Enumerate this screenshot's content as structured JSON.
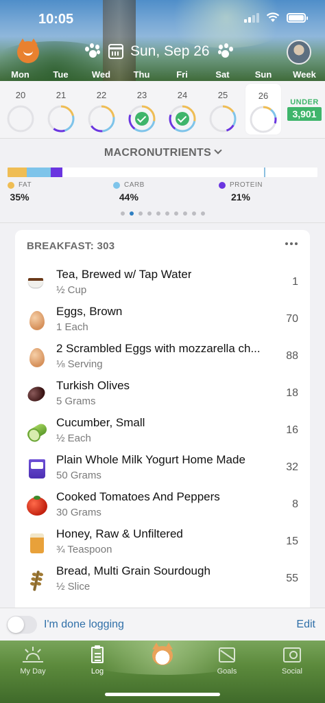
{
  "status": {
    "time": "10:05"
  },
  "header": {
    "date": "Sun, Sep 26",
    "weekdays": [
      "Mon",
      "Tue",
      "Wed",
      "Thu",
      "Fri",
      "Sat",
      "Sun",
      "Week"
    ]
  },
  "days": [
    {
      "num": "20",
      "fraction": 0.0,
      "done": false,
      "selected": false
    },
    {
      "num": "21",
      "fraction": 0.6,
      "done": false,
      "selected": false
    },
    {
      "num": "22",
      "fraction": 0.65,
      "done": false,
      "selected": false
    },
    {
      "num": "23",
      "fraction": 0.8,
      "done": true,
      "selected": false
    },
    {
      "num": "24",
      "fraction": 0.8,
      "done": true,
      "selected": false
    },
    {
      "num": "25",
      "fraction": 0.45,
      "done": false,
      "selected": false
    },
    {
      "num": "26",
      "fraction": 0.3,
      "done": false,
      "selected": true
    }
  ],
  "under": {
    "label": "UNDER",
    "value": "3,901"
  },
  "macros": {
    "title": "MACRONUTRIENTS",
    "fat": {
      "label": "FAT",
      "pct": "35%",
      "color": "#efbd54"
    },
    "carb": {
      "label": "CARB",
      "pct": "44%",
      "color": "#7ec4ea"
    },
    "protein": {
      "label": "PROTEIN",
      "pct": "21%",
      "color": "#6a35e0"
    },
    "pages": 10,
    "active_page": 1
  },
  "breakfast": {
    "title": "BREAKFAST: 303",
    "items": [
      {
        "name": "Tea, Brewed w/ Tap Water",
        "serving": "½ Cup",
        "cal": "1",
        "icon": "tea-cup-icon"
      },
      {
        "name": "Eggs, Brown",
        "serving": "1 Each",
        "cal": "70",
        "icon": "egg-icon"
      },
      {
        "name": "2 Scrambled Eggs with mozzarella ch...",
        "serving": "⅛ Serving",
        "cal": "88",
        "icon": "egg-icon"
      },
      {
        "name": "Turkish Olives",
        "serving": "5 Grams",
        "cal": "18",
        "icon": "olive-icon"
      },
      {
        "name": "Cucumber, Small",
        "serving": "½ Each",
        "cal": "16",
        "icon": "cucumber-icon"
      },
      {
        "name": "Plain Whole Milk Yogurt Home Made",
        "serving": "50 Grams",
        "cal": "32",
        "icon": "yogurt-icon"
      },
      {
        "name": "Cooked Tomatoes And Peppers",
        "serving": "30 Grams",
        "cal": "8",
        "icon": "tomato-icon"
      },
      {
        "name": "Honey, Raw & Unfiltered",
        "serving": "¾ Teaspoon",
        "cal": "15",
        "icon": "honey-jar-icon"
      },
      {
        "name": "Bread, Multi Grain Sourdough",
        "serving": "½ Slice",
        "cal": "55",
        "icon": "wheat-icon"
      }
    ]
  },
  "done": {
    "label": "I'm done logging",
    "edit": "Edit"
  },
  "tabs": [
    {
      "label": "My Day",
      "icon": "sunrise-icon"
    },
    {
      "label": "Log",
      "icon": "clipboard-icon"
    },
    {
      "label": "",
      "icon": "cat-mascot-icon"
    },
    {
      "label": "Goals",
      "icon": "goals-chart-icon"
    },
    {
      "label": "Social",
      "icon": "social-icon"
    }
  ]
}
